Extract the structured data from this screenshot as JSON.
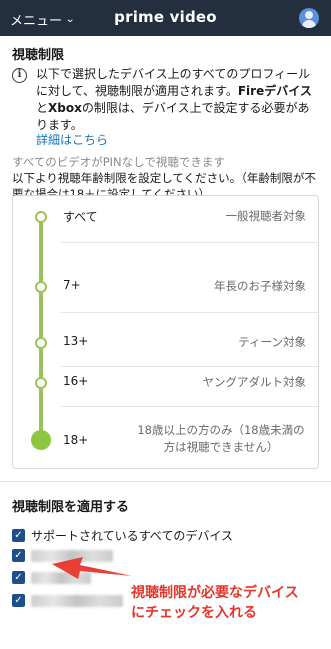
{
  "header": {
    "menu_label": "メニュー",
    "brand": "prime video"
  },
  "section": {
    "title": "視聴制限",
    "info_pre": "以下で選択したデバイス上のすべてのプロフィールに対して、視聴制限が適用されます。",
    "info_fire": "Fireデバイス",
    "info_and": "と",
    "info_xbox": "Xbox",
    "info_post": "の制限は、デバイス上で設定する必要があります。",
    "more_link": "詳細はこちら",
    "no_pin_note": "すべてのビデオがPINなしで視聴できます",
    "instruction": "以下より視聴年齢制限を設定してください。（年齢制限が不要な場合は18＋に設定してください）"
  },
  "ratings": [
    {
      "label": "すべて",
      "desc": "一般視聴者対象"
    },
    {
      "label": "7+",
      "desc": "年長のお子様対象"
    },
    {
      "label": "13+",
      "desc": "ティーン対象"
    },
    {
      "label": "16+",
      "desc": "ヤングアダルト対象"
    },
    {
      "label": "18+",
      "desc": "18歳以上の方のみ（18歳未満の方は視聴できません）"
    }
  ],
  "selected_rating": "18+",
  "devices": {
    "title": "視聴制限を適用する",
    "all_devices_label": "サポートされているすべてのデバイス",
    "all_devices_checked": true,
    "device_checkboxes_checked": [
      true,
      true,
      true
    ]
  },
  "annotation": {
    "line1": "視聴制限が必要なデバイス",
    "line2": "にチェックを入れる"
  },
  "colors": {
    "topbar": "#232f3e",
    "accent_green": "#8dc63f",
    "link": "#1a73b8",
    "checkbox": "#1f4e8c",
    "annotation": "#e8352b"
  }
}
